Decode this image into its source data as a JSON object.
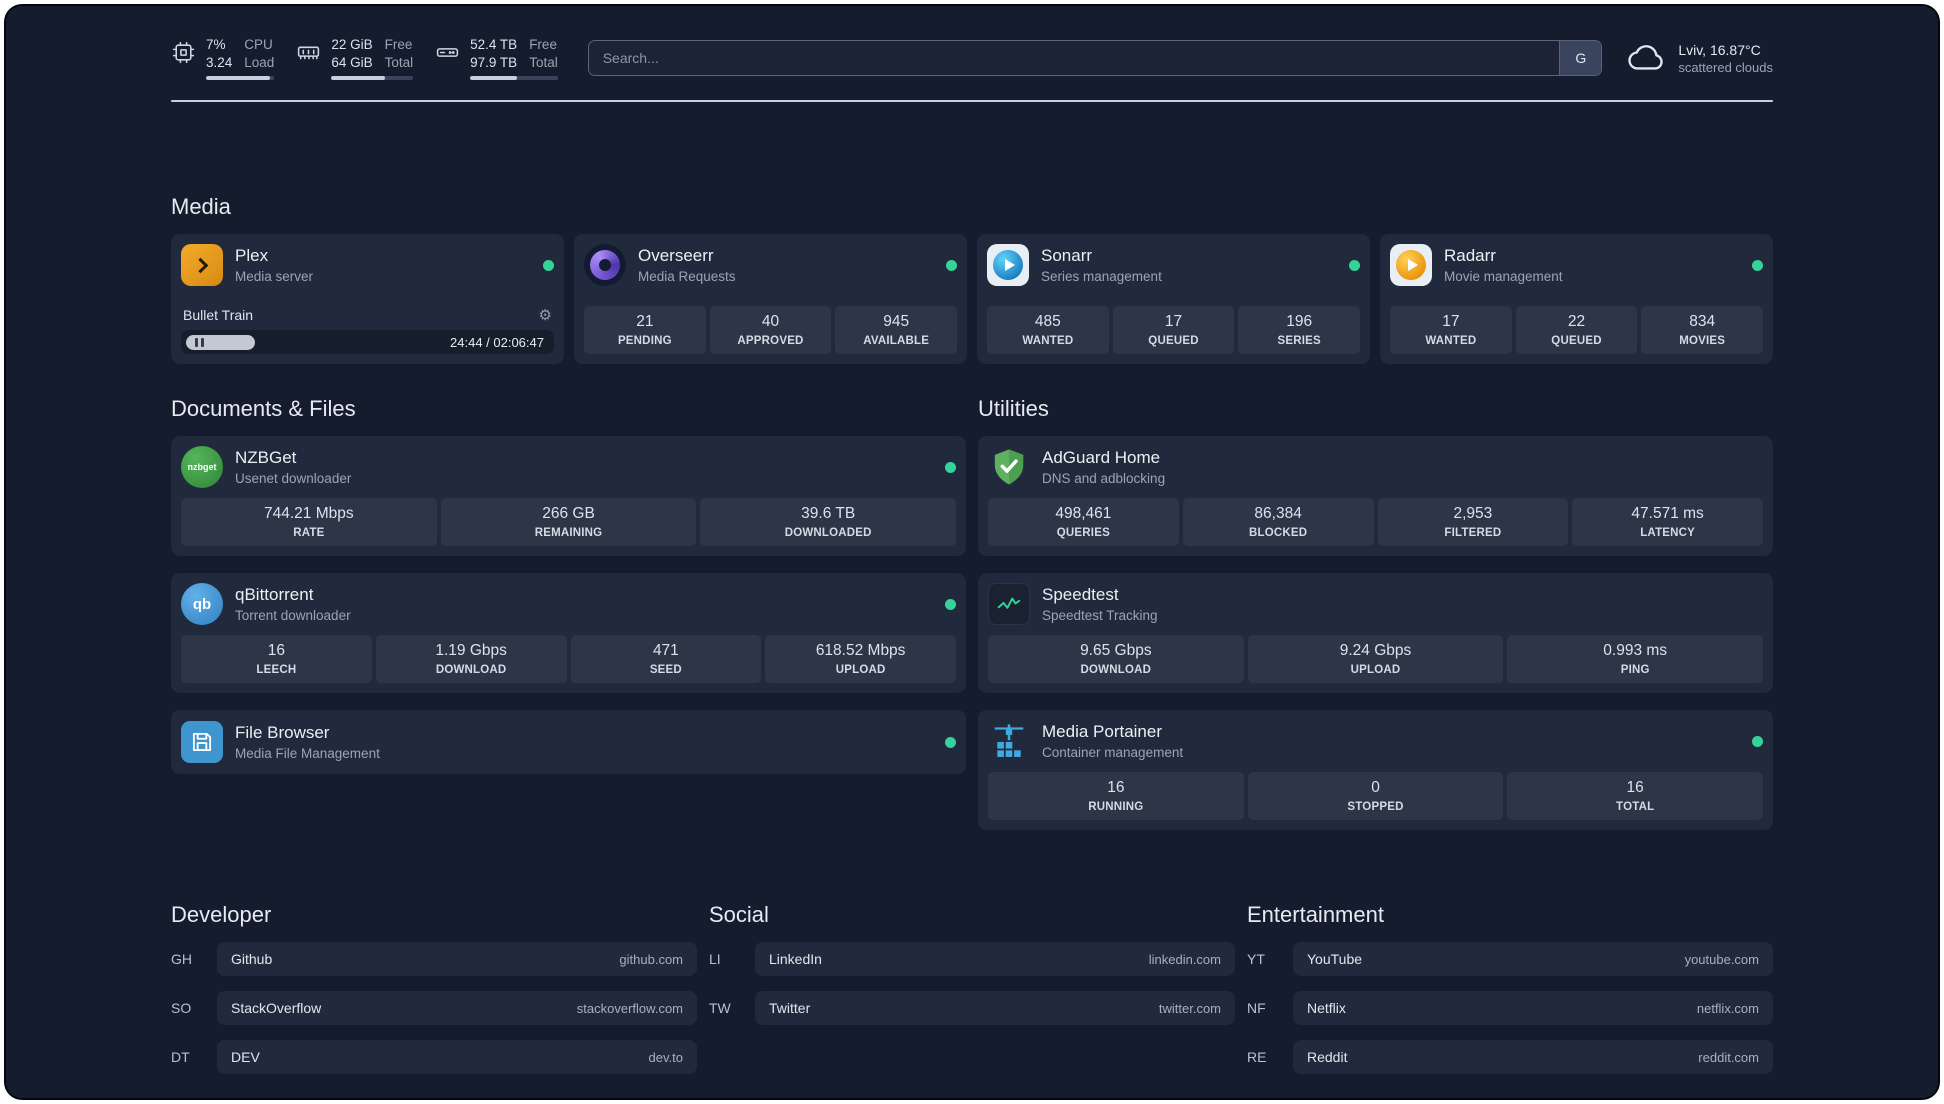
{
  "topbar": {
    "cpu": {
      "value_top": "7%",
      "value_bottom": "3.24",
      "label_top": "CPU",
      "label_bottom": "Load",
      "bar_percent": 93
    },
    "ram": {
      "value_top": "22 GiB",
      "value_bottom": "64 GiB",
      "label_top": "Free",
      "label_bottom": "Total",
      "bar_percent": 66
    },
    "disk": {
      "value_top": "52.4 TB",
      "value_bottom": "97.9 TB",
      "label_top": "Free",
      "label_bottom": "Total",
      "bar_percent": 54
    },
    "search": {
      "placeholder": "Search...",
      "provider_button": "G"
    },
    "weather": {
      "location": "Lviv, 16.87°C",
      "condition": "scattered clouds"
    }
  },
  "media": {
    "title": "Media",
    "plex": {
      "name": "Plex",
      "subtitle": "Media server",
      "status": "online",
      "player": {
        "title": "Bullet Train",
        "time": "24:44 / 02:06:47",
        "progress_percent": 19
      }
    },
    "overseerr": {
      "name": "Overseerr",
      "subtitle": "Media Requests",
      "status": "online",
      "stats": [
        {
          "value": "21",
          "label": "PENDING"
        },
        {
          "value": "40",
          "label": "APPROVED"
        },
        {
          "value": "945",
          "label": "AVAILABLE"
        }
      ]
    },
    "sonarr": {
      "name": "Sonarr",
      "subtitle": "Series management",
      "status": "online",
      "stats": [
        {
          "value": "485",
          "label": "WANTED"
        },
        {
          "value": "17",
          "label": "QUEUED"
        },
        {
          "value": "196",
          "label": "SERIES"
        }
      ]
    },
    "radarr": {
      "name": "Radarr",
      "subtitle": "Movie management",
      "status": "online",
      "stats": [
        {
          "value": "17",
          "label": "WANTED"
        },
        {
          "value": "22",
          "label": "QUEUED"
        },
        {
          "value": "834",
          "label": "MOVIES"
        }
      ]
    }
  },
  "documents": {
    "title": "Documents & Files",
    "nzbget": {
      "name": "NZBGet",
      "subtitle": "Usenet downloader",
      "status": "online",
      "icon_text": "nzbget",
      "stats": [
        {
          "value": "744.21 Mbps",
          "label": "RATE"
        },
        {
          "value": "266 GB",
          "label": "REMAINING"
        },
        {
          "value": "39.6 TB",
          "label": "DOWNLOADED"
        }
      ]
    },
    "qbittorrent": {
      "name": "qBittorrent",
      "subtitle": "Torrent downloader",
      "status": "online",
      "icon_text": "qb",
      "stats": [
        {
          "value": "16",
          "label": "LEECH"
        },
        {
          "value": "1.19 Gbps",
          "label": "DOWNLOAD"
        },
        {
          "value": "471",
          "label": "SEED"
        },
        {
          "value": "618.52 Mbps",
          "label": "UPLOAD"
        }
      ]
    },
    "filebrowser": {
      "name": "File Browser",
      "subtitle": "Media File Management",
      "status": "online"
    }
  },
  "utilities": {
    "title": "Utilities",
    "adguard": {
      "name": "AdGuard Home",
      "subtitle": "DNS and adblocking",
      "stats": [
        {
          "value": "498,461",
          "label": "QUERIES"
        },
        {
          "value": "86,384",
          "label": "BLOCKED"
        },
        {
          "value": "2,953",
          "label": "FILTERED"
        },
        {
          "value": "47.571 ms",
          "label": "LATENCY"
        }
      ]
    },
    "speedtest": {
      "name": "Speedtest",
      "subtitle": "Speedtest Tracking",
      "stats": [
        {
          "value": "9.65 Gbps",
          "label": "DOWNLOAD"
        },
        {
          "value": "9.24 Gbps",
          "label": "UPLOAD"
        },
        {
          "value": "0.993 ms",
          "label": "PING"
        }
      ]
    },
    "portainer": {
      "name": "Media Portainer",
      "subtitle": "Container management",
      "status": "online",
      "stats": [
        {
          "value": "16",
          "label": "RUNNING"
        },
        {
          "value": "0",
          "label": "STOPPED"
        },
        {
          "value": "16",
          "label": "TOTAL"
        }
      ]
    }
  },
  "links": {
    "developer": {
      "title": "Developer",
      "items": [
        {
          "abbr": "GH",
          "name": "Github",
          "url": "github.com"
        },
        {
          "abbr": "SO",
          "name": "StackOverflow",
          "url": "stackoverflow.com"
        },
        {
          "abbr": "DT",
          "name": "DEV",
          "url": "dev.to"
        }
      ]
    },
    "social": {
      "title": "Social",
      "items": [
        {
          "abbr": "LI",
          "name": "LinkedIn",
          "url": "linkedin.com"
        },
        {
          "abbr": "TW",
          "name": "Twitter",
          "url": "twitter.com"
        }
      ]
    },
    "entertainment": {
      "title": "Entertainment",
      "items": [
        {
          "abbr": "YT",
          "name": "YouTube",
          "url": "youtube.com"
        },
        {
          "abbr": "NF",
          "name": "Netflix",
          "url": "netflix.com"
        },
        {
          "abbr": "RE",
          "name": "Reddit",
          "url": "reddit.com"
        }
      ]
    }
  },
  "colors": {
    "status_online": "#34d399",
    "accent_bar": "#c8cfdc"
  }
}
